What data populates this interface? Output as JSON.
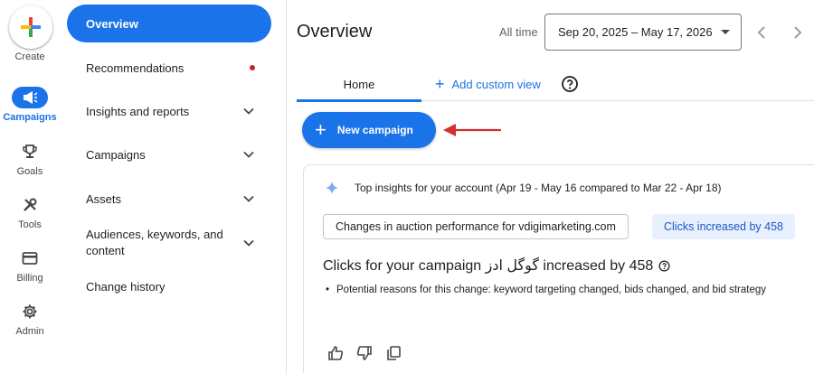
{
  "rail": {
    "create_label": "Create",
    "items": [
      {
        "label": "Campaigns",
        "icon": "megaphone-icon",
        "active": true
      },
      {
        "label": "Goals",
        "icon": "trophy-icon",
        "active": false
      },
      {
        "label": "Tools",
        "icon": "tools-icon",
        "active": false
      },
      {
        "label": "Billing",
        "icon": "credit-card-icon",
        "active": false
      },
      {
        "label": "Admin",
        "icon": "gear-icon",
        "active": false
      }
    ]
  },
  "nav": {
    "items": [
      {
        "label": "Overview",
        "active": true
      },
      {
        "label": "Recommendations",
        "badge": "red-dot"
      },
      {
        "label": "Insights and reports",
        "expandable": true
      },
      {
        "label": "Campaigns",
        "expandable": true
      },
      {
        "label": "Assets",
        "expandable": true
      },
      {
        "label": "Audiences, keywords, and content",
        "expandable": true
      },
      {
        "label": "Change history"
      }
    ]
  },
  "header": {
    "title": "Overview",
    "all_time": "All time",
    "date_range": "Sep 20, 2025 – May 17, 2026"
  },
  "tabs": {
    "home": "Home",
    "add_custom_view": "Add custom view"
  },
  "new_campaign_label": "New campaign",
  "insight_card": {
    "heading": "Top insights for your account (Apr 19 - May 16 compared to Mar 22 - Apr 18)",
    "chip_outline": "Changes in auction performance for vdigimarketing.com",
    "chip_filled": "Clicks increased by 458",
    "title": "Clicks for your campaign گوگل ادز increased by 458",
    "bullet": "Potential reasons for this change: keyword targeting changed, bids changed, and bid strategy"
  },
  "colors": {
    "accent": "#1a73e8",
    "alert_dot": "#c5221f",
    "arrow": "#d32f2f",
    "chip_filled_bg": "#e8f0fe"
  }
}
